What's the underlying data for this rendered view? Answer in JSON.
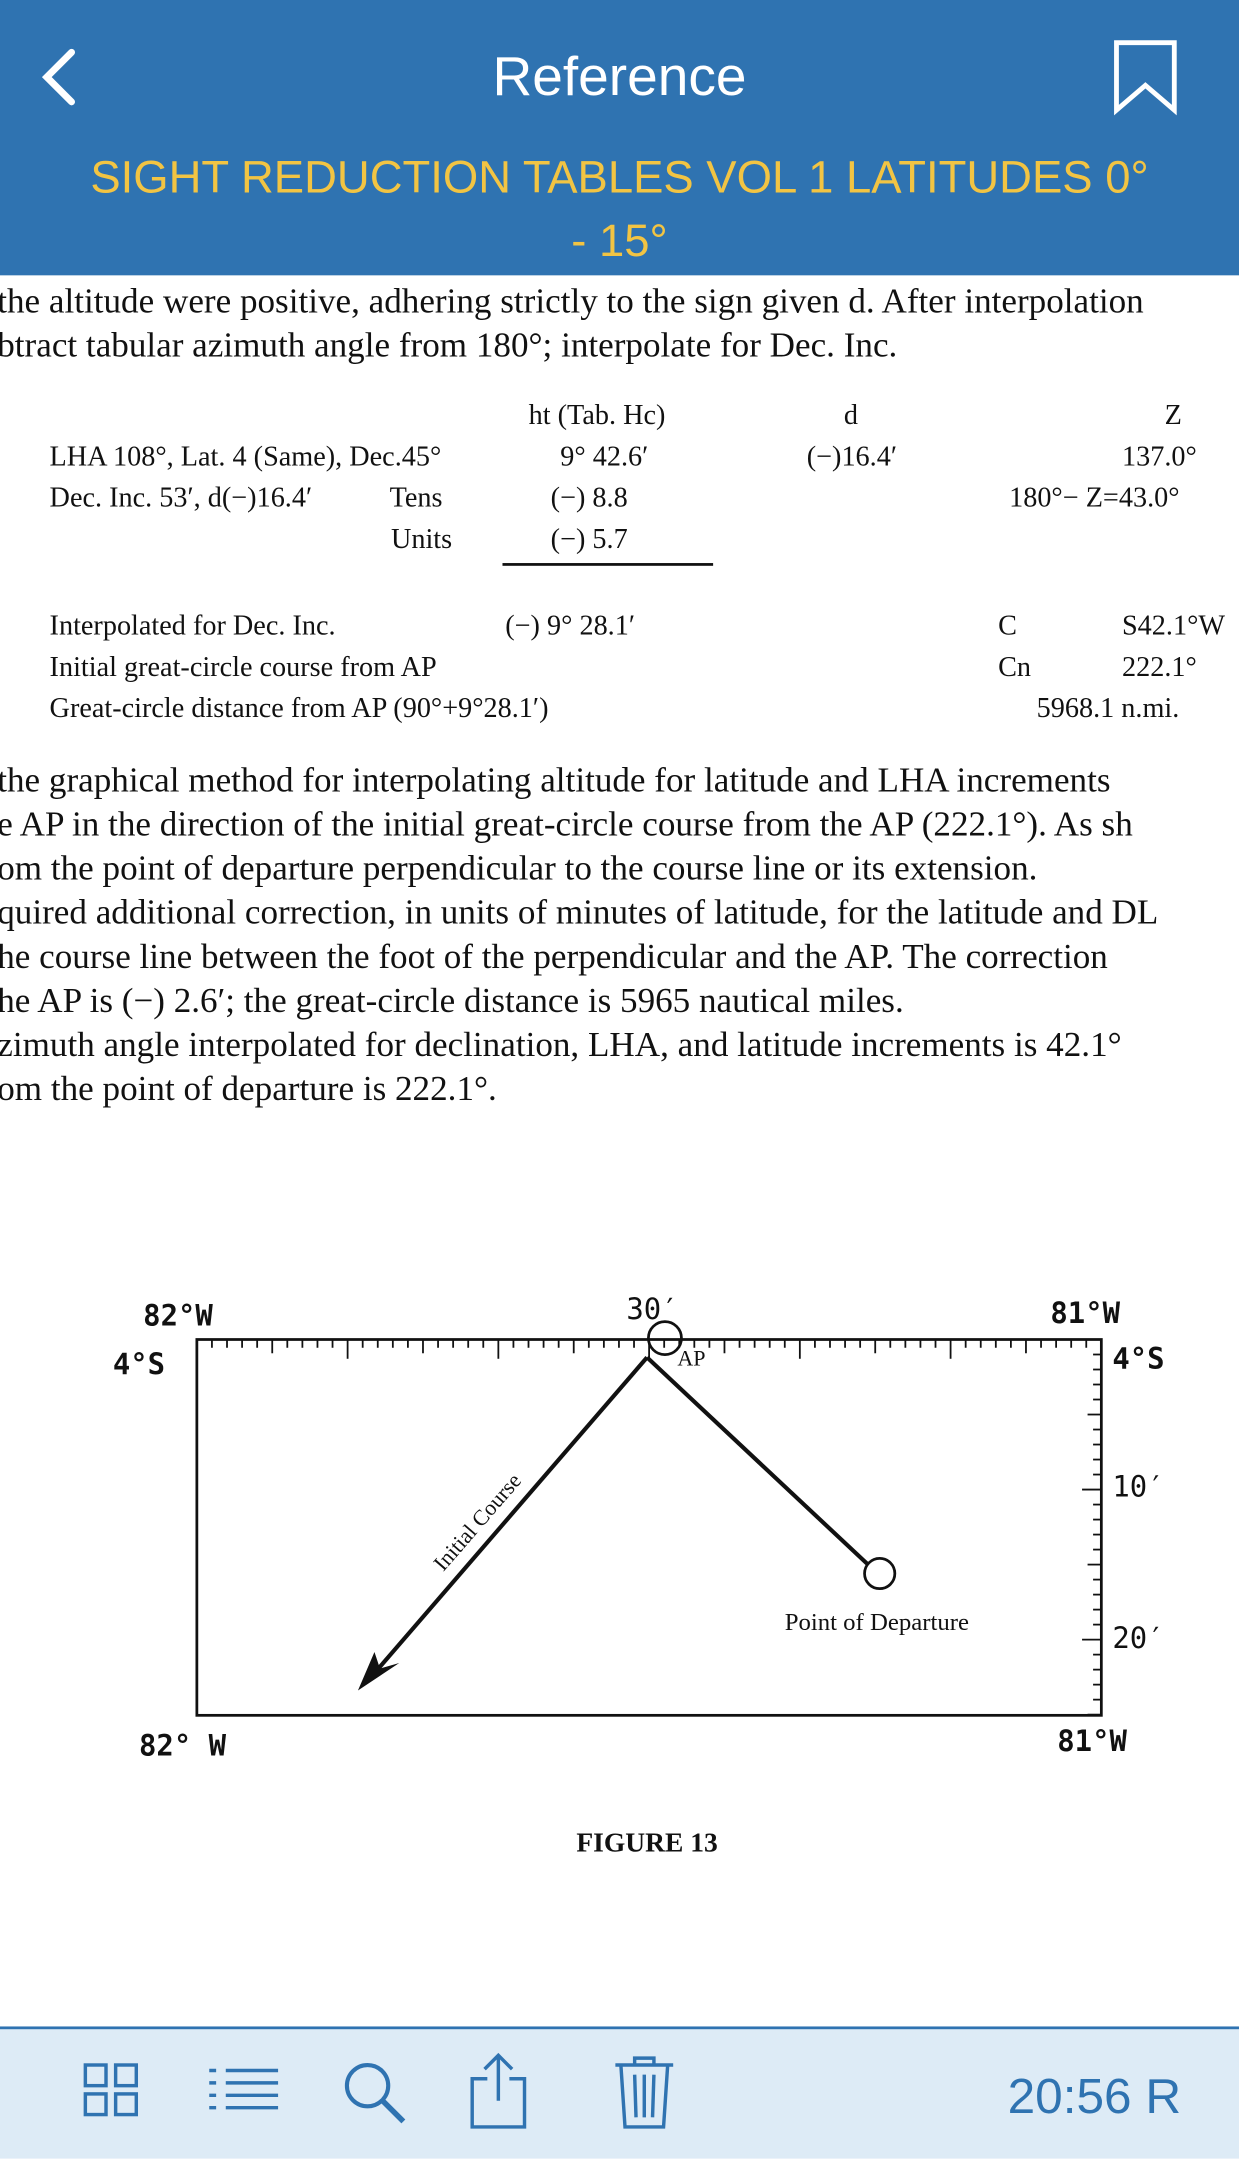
{
  "header": {
    "title": "Reference",
    "subtitle_line1": "SIGHT REDUCTION TABLES VOL 1 LATITUDES 0°",
    "subtitle_line2": "- 15°",
    "back_icon": "chevron-left-icon",
    "bookmark_icon": "bookmark-icon"
  },
  "colors": {
    "header_bg": "#2F73B1",
    "subtitle": "#F2C443",
    "footer_bg": "#DDEBF6",
    "accent": "#2F73B1"
  },
  "intro": [
    "the altitude were positive, adhering strictly to the sign given d. After interpolation",
    "btract tabular azimuth angle from 180°; interpolate for Dec. Inc."
  ],
  "table": {
    "headers": {
      "ht": "ht (Tab. Hc)",
      "d": "d",
      "z": "Z"
    },
    "row1": {
      "label": "LHA 108°, Lat. 4  (Same), Dec.45°",
      "ht": "9° 42.6′",
      "d": "(−)16.4′",
      "z": "137.0°"
    },
    "row2": {
      "label": "Dec. Inc. 53′, d(−)16.4′",
      "sub": "Tens",
      "ht": "(−)  8.8",
      "z": "180°− Z=43.0°"
    },
    "row3": {
      "sub": "Units",
      "ht": "(−)  5.7"
    },
    "row4": {
      "label": "Interpolated for Dec. Inc.",
      "ht": "(−)  9° 28.1′",
      "c": "C",
      "cv": "S42.1°W"
    },
    "row5": {
      "label": "Initial great-circle course from AP",
      "c": "Cn",
      "cv": "222.1°"
    },
    "row6": {
      "label": "Great-circle distance from AP (90°+9°28.1′)",
      "cv": "5968.1 n.mi."
    }
  },
  "body": [
    "the graphical method for interpolating altitude for latitude and LHA increments",
    "e AP in the direction of the initial great-circle course from the AP (222.1°). As sh",
    "om the point of departure perpendicular to the course line or its extension.",
    "quired additional correction, in units of minutes of latitude, for the latitude and DL",
    "he course line between the foot of the perpendicular and the AP. The correction",
    "he AP is (−) 2.6′; the great-circle distance is 5965 nautical miles.",
    "zimuth angle interpolated for declination, LHA, and latitude increments is 42.1°",
    "om the point of departure is 222.1°."
  ],
  "figure": {
    "lon_left_top": "82°W",
    "lat_left": "4°S",
    "min_top": "30′",
    "lon_right_top": "81°W",
    "lat_right": "4°S",
    "min_10": "10′",
    "min_20": "20′",
    "lon_left_bottom": "82° W",
    "lon_right_bottom": "81°W",
    "ap": "AP",
    "course": "Initial Course",
    "departure": "Point of Departure",
    "caption": "FIGURE 13"
  },
  "footer": {
    "time": "20:56 R",
    "icons": [
      "grid-icon",
      "list-icon",
      "search-icon",
      "share-icon",
      "trash-icon"
    ]
  }
}
